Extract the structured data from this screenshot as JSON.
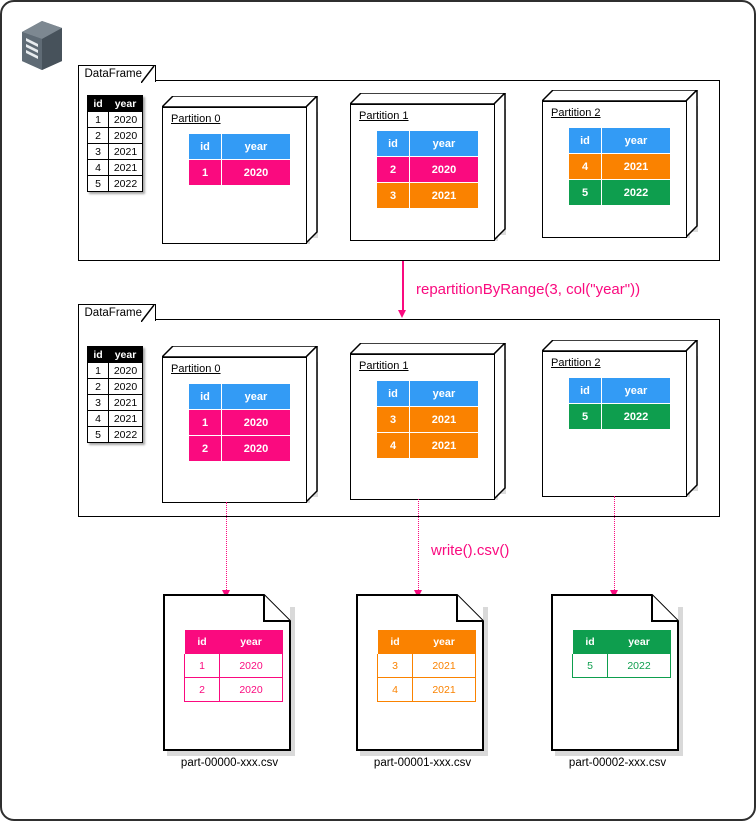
{
  "icons": {
    "server": "server-icon"
  },
  "dataframe_label": "DataFrame",
  "source_table": {
    "headers": [
      "id",
      "year"
    ],
    "rows": [
      [
        "1",
        "2020"
      ],
      [
        "2",
        "2020"
      ],
      [
        "3",
        "2021"
      ],
      [
        "4",
        "2021"
      ],
      [
        "5",
        "2022"
      ]
    ]
  },
  "colors": {
    "header_blue": "#339BF5",
    "pink": "#FA0A7F",
    "orange": "#FA8200",
    "green": "#0E9E4E",
    "accent_text": "#FA0A7F"
  },
  "before": {
    "title": "DataFrame",
    "partitions": [
      {
        "label": "Partition 0",
        "headers": [
          "id",
          "year"
        ],
        "rows": [
          {
            "id": "1",
            "year": "2020",
            "color": "pink"
          }
        ]
      },
      {
        "label": "Partition 1",
        "headers": [
          "id",
          "year"
        ],
        "rows": [
          {
            "id": "2",
            "year": "2020",
            "color": "pink"
          },
          {
            "id": "3",
            "year": "2021",
            "color": "orange"
          }
        ]
      },
      {
        "label": "Partition 2",
        "headers": [
          "id",
          "year"
        ],
        "rows": [
          {
            "id": "4",
            "year": "2021",
            "color": "orange"
          },
          {
            "id": "5",
            "year": "2022",
            "color": "green"
          }
        ]
      }
    ]
  },
  "transform_label": "repartitionByRange(3, col(\"year\"))",
  "after": {
    "title": "DataFrame",
    "partitions": [
      {
        "label": "Partition 0",
        "headers": [
          "id",
          "year"
        ],
        "rows": [
          {
            "id": "1",
            "year": "2020",
            "color": "pink"
          },
          {
            "id": "2",
            "year": "2020",
            "color": "pink"
          }
        ]
      },
      {
        "label": "Partition 1",
        "headers": [
          "id",
          "year"
        ],
        "rows": [
          {
            "id": "3",
            "year": "2021",
            "color": "orange"
          },
          {
            "id": "4",
            "year": "2021",
            "color": "orange"
          }
        ]
      },
      {
        "label": "Partition 2",
        "headers": [
          "id",
          "year"
        ],
        "rows": [
          {
            "id": "5",
            "year": "2022",
            "color": "green"
          }
        ]
      }
    ]
  },
  "write_label": "write().csv()",
  "files": [
    {
      "name": "part-00000-xxx.csv",
      "theme": "pink",
      "headers": [
        "id",
        "year"
      ],
      "rows": [
        [
          "1",
          "2020"
        ],
        [
          "2",
          "2020"
        ]
      ]
    },
    {
      "name": "part-00001-xxx.csv",
      "theme": "orange",
      "headers": [
        "id",
        "year"
      ],
      "rows": [
        [
          "3",
          "2021"
        ],
        [
          "4",
          "2021"
        ]
      ]
    },
    {
      "name": "part-00002-xxx.csv",
      "theme": "green",
      "headers": [
        "id",
        "year"
      ],
      "rows": [
        [
          "5",
          "2022"
        ]
      ]
    }
  ]
}
